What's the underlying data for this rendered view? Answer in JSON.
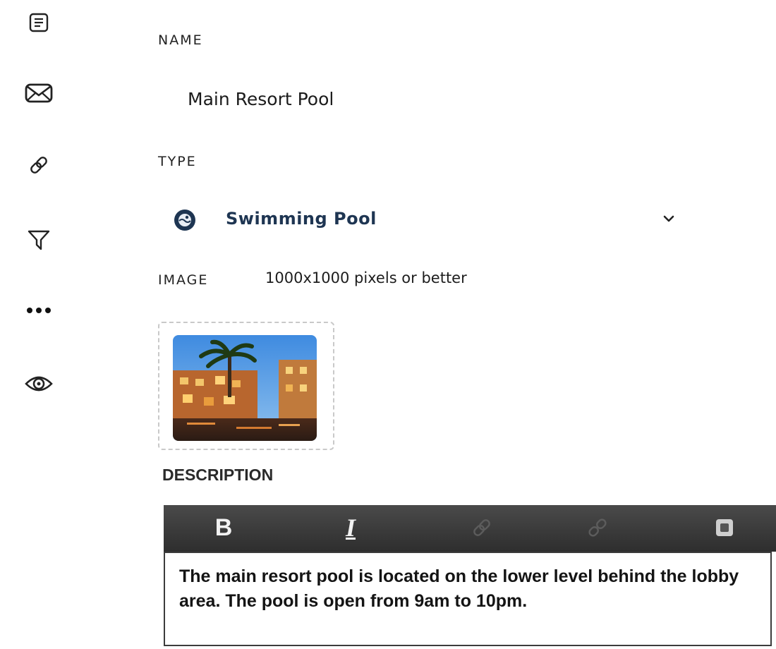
{
  "sidebar": {
    "icons": [
      "document-icon",
      "mail-icon",
      "link-icon",
      "filter-icon",
      "more-icon",
      "eye-icon"
    ]
  },
  "form": {
    "name_label": "NAME",
    "name_value": "Main Resort Pool",
    "type_label": "TYPE",
    "type_value": "Swimming Pool",
    "image_label": "IMAGE",
    "image_hint": "1000x1000 pixels or better",
    "description_label": "DESCRIPTION",
    "description_text": "The main resort pool is located on the lower level behind the lobby area. The pool is open from 9am to 10pm."
  },
  "editor": {
    "bold_label": "B",
    "italic_label": "I",
    "tools": [
      "bold-icon",
      "italic-icon",
      "link-icon",
      "unlink-icon",
      "image-icon"
    ]
  },
  "colors": {
    "type_text": "#1e3552",
    "toolbar_bg": "#3a3a3a",
    "pool_icon_bg": "#1e3552"
  }
}
